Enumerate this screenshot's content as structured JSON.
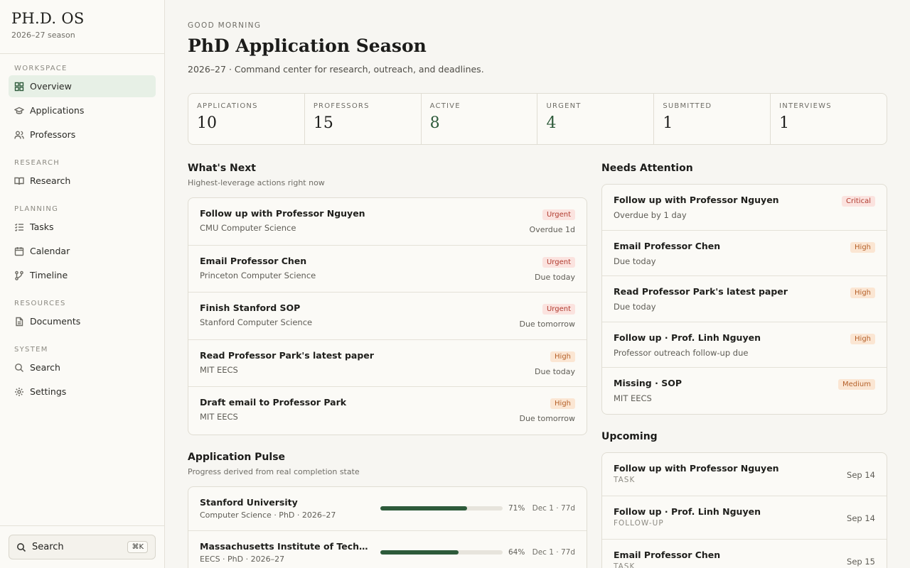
{
  "brand": {
    "title": "PH.D. OS",
    "season": "2026–27 season"
  },
  "nav": {
    "workspace": "WORKSPACE",
    "overview": "Overview",
    "applications": "Applications",
    "professors": "Professors",
    "research_section": "RESEARCH",
    "research": "Research",
    "planning": "PLANNING",
    "tasks": "Tasks",
    "calendar": "Calendar",
    "timeline": "Timeline",
    "resources": "RESOURCES",
    "documents": "Documents",
    "system": "SYSTEM",
    "search": "Search",
    "settings": "Settings"
  },
  "footer": {
    "search_label": "Search",
    "shortcut": "⌘K"
  },
  "header": {
    "greeting": "GOOD MORNING",
    "title": "PhD Application Season",
    "subtitle": "2026–27 · Command center for research, outreach, and deadlines."
  },
  "stats": [
    {
      "label": "APPLICATIONS",
      "value": "10"
    },
    {
      "label": "PROFESSORS",
      "value": "15"
    },
    {
      "label": "ACTIVE",
      "value": "8"
    },
    {
      "label": "URGENT",
      "value": "4"
    },
    {
      "label": "SUBMITTED",
      "value": "1"
    },
    {
      "label": "INTERVIEWS",
      "value": "1"
    }
  ],
  "whats_next": {
    "title": "What's Next",
    "subtitle": "Highest-leverage actions right now",
    "items": [
      {
        "title": "Follow up with Professor Nguyen",
        "sub": "CMU Computer Science",
        "badge": "Urgent",
        "meta": "Overdue 1d"
      },
      {
        "title": "Email Professor Chen",
        "sub": "Princeton Computer Science",
        "badge": "Urgent",
        "meta": "Due today"
      },
      {
        "title": "Finish Stanford SOP",
        "sub": "Stanford Computer Science",
        "badge": "Urgent",
        "meta": "Due tomorrow"
      },
      {
        "title": "Read Professor Park's latest paper",
        "sub": "MIT EECS",
        "badge": "High",
        "meta": "Due today"
      },
      {
        "title": "Draft email to Professor Park",
        "sub": "MIT EECS",
        "badge": "High",
        "meta": "Due tomorrow"
      }
    ]
  },
  "pulse": {
    "title": "Application Pulse",
    "subtitle": "Progress derived from real completion state",
    "items": [
      {
        "title": "Stanford University",
        "sub": "Computer Science · PhD · 2026–27",
        "progress": 71,
        "pct": "71%",
        "due": "Dec 1 · 77d"
      },
      {
        "title": "Massachusetts Institute of Technology",
        "sub": "EECS · PhD · 2026–27",
        "progress": 64,
        "pct": "64%",
        "due": "Dec 1 · 77d"
      }
    ]
  },
  "attention": {
    "title": "Needs Attention",
    "items": [
      {
        "title": "Follow up with Professor Nguyen",
        "sub": "Overdue by 1 day",
        "badge": "Critical"
      },
      {
        "title": "Email Professor Chen",
        "sub": "Due today",
        "badge": "High"
      },
      {
        "title": "Read Professor Park's latest paper",
        "sub": "Due today",
        "badge": "High"
      },
      {
        "title": "Follow up · Prof. Linh Nguyen",
        "sub": "Professor outreach follow-up due",
        "badge": "High"
      },
      {
        "title": "Missing · SOP",
        "sub": "MIT EECS",
        "badge": "Medium"
      }
    ]
  },
  "upcoming": {
    "title": "Upcoming",
    "items": [
      {
        "title": "Follow up with Professor Nguyen",
        "type": "TASK",
        "date": "Sep 14"
      },
      {
        "title": "Follow up · Prof. Linh Nguyen",
        "type": "FOLLOW-UP",
        "date": "Sep 14"
      },
      {
        "title": "Email Professor Chen",
        "type": "TASK",
        "date": "Sep 15"
      }
    ]
  },
  "colors": {
    "accent": "#2d5a3a",
    "badge_red": "#b03a2e",
    "badge_orange": "#b5612a"
  }
}
